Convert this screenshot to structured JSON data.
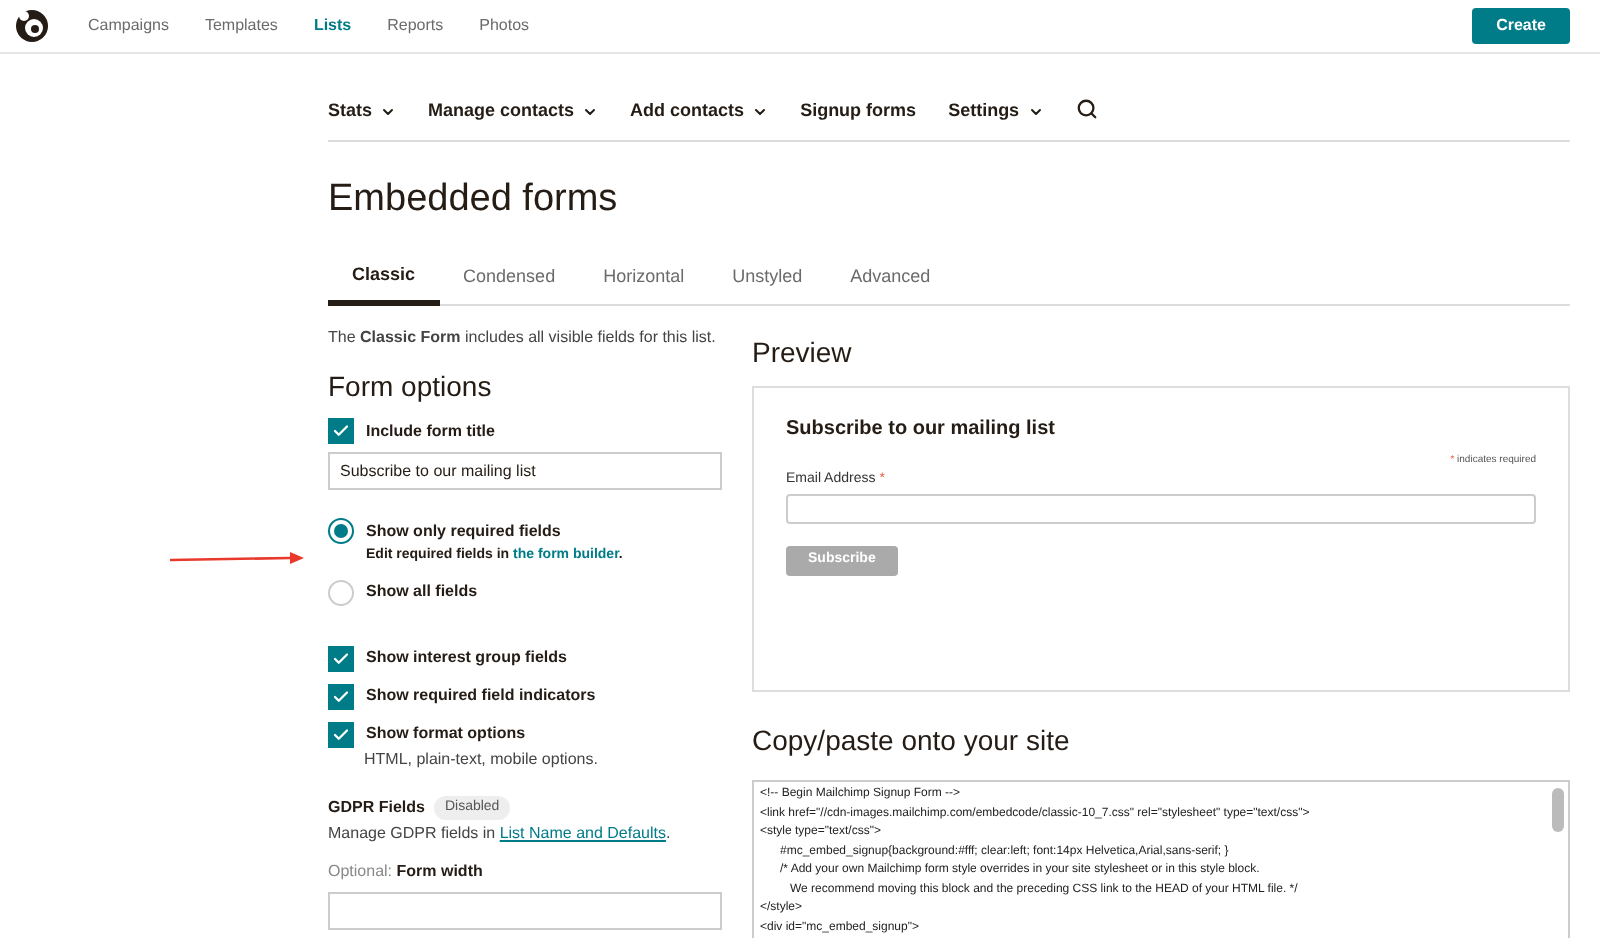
{
  "top_nav": {
    "items": [
      {
        "label": "Campaigns",
        "selected": false
      },
      {
        "label": "Templates",
        "selected": false
      },
      {
        "label": "Lists",
        "selected": true
      },
      {
        "label": "Reports",
        "selected": false
      },
      {
        "label": "Photos",
        "selected": false
      }
    ],
    "create_button": "Create"
  },
  "sub_nav": [
    {
      "label": "Stats",
      "dropdown": true
    },
    {
      "label": "Manage contacts",
      "dropdown": true
    },
    {
      "label": "Add contacts",
      "dropdown": true
    },
    {
      "label": "Signup forms",
      "dropdown": false
    },
    {
      "label": "Settings",
      "dropdown": true
    }
  ],
  "page_title": "Embedded forms",
  "tabs": [
    {
      "label": "Classic",
      "selected": true
    },
    {
      "label": "Condensed",
      "selected": false
    },
    {
      "label": "Horizontal",
      "selected": false
    },
    {
      "label": "Unstyled",
      "selected": false
    },
    {
      "label": "Advanced",
      "selected": false
    }
  ],
  "description": "The **Classic Form** includes all visible fields for this list.",
  "form_options": {
    "heading": "Form options",
    "include_title": {
      "label": "Include form title",
      "checked": true
    },
    "title_value": "Subscribe to our mailing list",
    "radios": [
      {
        "label": "Show only required fields",
        "selected": true,
        "hint": "Edit required fields in ",
        "hint_link": "the form builder",
        "hint_end": "."
      },
      {
        "label": "Show all fields",
        "selected": false
      }
    ],
    "checkboxes": [
      {
        "label": "Show interest group fields",
        "checked": true
      },
      {
        "label": "Show required field indicators",
        "checked": true
      },
      {
        "label": "Show format options",
        "checked": true,
        "hint": "HTML, plain-text, mobile options."
      }
    ],
    "gdpr": {
      "label": "GDPR Fields",
      "badge": "Disabled",
      "text": "Manage GDPR fields in ",
      "link": "List Name and Defaults",
      "text_end": "."
    },
    "width": {
      "optional": "Optional:",
      "label": "Form width"
    }
  },
  "preview": {
    "heading": "Preview",
    "form_title": "Subscribe to our mailing list",
    "required_mark": "*",
    "required_note": "indicates required",
    "email_label": "Email Address",
    "subscribe_button": "Subscribe"
  },
  "copy": {
    "heading": "Copy/paste onto your site",
    "code_lines": [
      "<!-- Begin Mailchimp Signup Form -->",
      "<link href=\"//cdn-images.mailchimp.com/embedcode/classic-10_7.css\" rel=\"stylesheet\" type=\"text/css\">",
      "<style type=\"text/css\">",
      "      #mc_embed_signup{background:#fff; clear:left; font:14px Helvetica,Arial,sans-serif; }",
      "      /* Add your own Mailchimp form style overrides in your site stylesheet or in this style block.",
      "         We recommend moving this block and the preceding CSS link to the HEAD of your HTML file. */",
      "</style>",
      "<div id=\"mc_embed_signup\">"
    ]
  }
}
